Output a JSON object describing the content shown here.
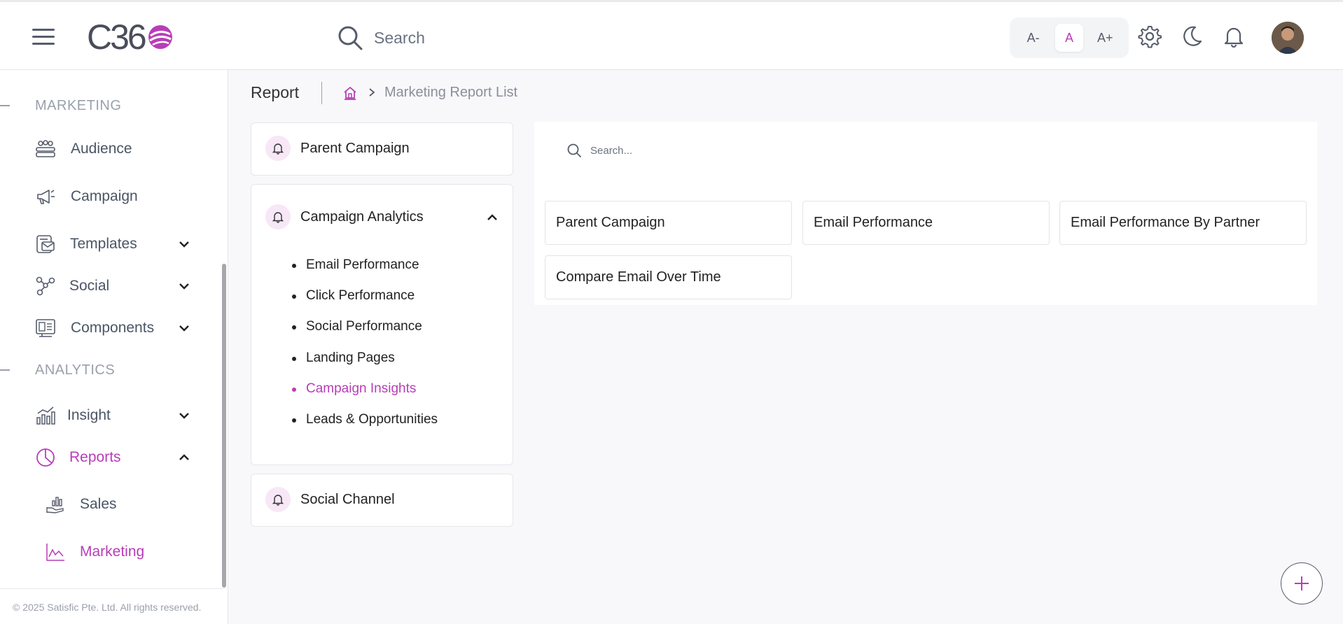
{
  "header": {
    "logo_text": "C36",
    "search_placeholder": "Search",
    "font_controls": [
      "A-",
      "A",
      "A+"
    ],
    "icons": [
      "settings-icon",
      "moon-icon",
      "bell-icon"
    ]
  },
  "sidebar": {
    "sections": {
      "marketing": "MARKETING",
      "analytics": "ANALYTICS"
    },
    "items": {
      "audience": "Audience",
      "campaign": "Campaign",
      "templates": "Templates",
      "social": "Social",
      "components": "Components",
      "insight": "Insight",
      "reports": "Reports",
      "sales": "Sales",
      "marketing": "Marketing"
    },
    "footer": "© 2025 Satisfic Pte. Ltd. All rights reserved."
  },
  "breadcrumb": {
    "title": "Report",
    "current": "Marketing Report List"
  },
  "left_panel": {
    "parent_campaign": "Parent Campaign",
    "campaign_analytics": "Campaign Analytics",
    "sub_items": [
      "Email Performance",
      "Click Performance",
      "Social Performance",
      "Landing Pages",
      "Campaign Insights",
      "Leads & Opportunities"
    ],
    "social_channel": "Social Channel"
  },
  "right_panel": {
    "search_placeholder": "Search...",
    "tiles": [
      "Parent Campaign",
      "Email Performance",
      "Email Performance By Partner",
      "Compare Email Over Time"
    ]
  },
  "colors": {
    "accent": "#b83db8",
    "text": "#4b5565",
    "muted": "#9aa0ab"
  }
}
